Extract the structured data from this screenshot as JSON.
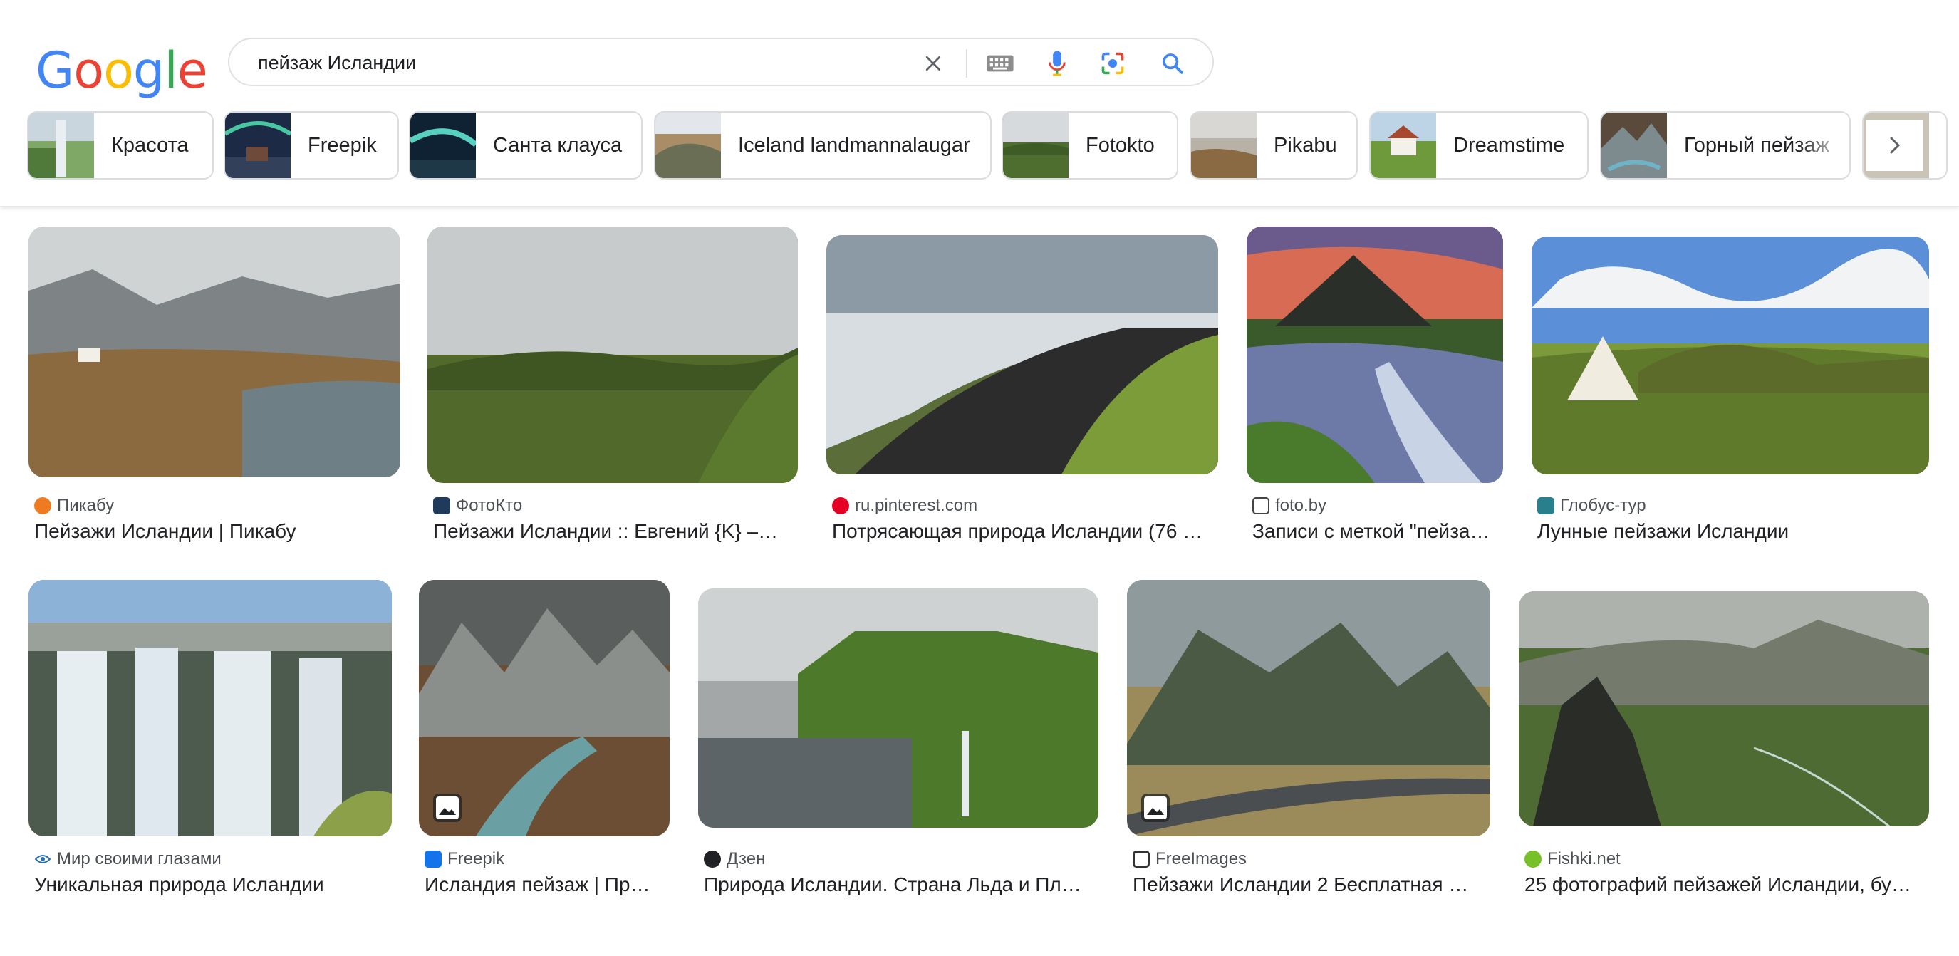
{
  "search": {
    "query": "пейзаж Исландии"
  },
  "logo": {
    "letters": [
      "G",
      "o",
      "o",
      "g",
      "l",
      "e"
    ],
    "colors": [
      "#4285F4",
      "#EA4335",
      "#FBBC05",
      "#4285F4",
      "#34A853",
      "#EA4335"
    ]
  },
  "chips": [
    {
      "label": "Красота"
    },
    {
      "label": "Freepik"
    },
    {
      "label": "Санта клауса"
    },
    {
      "label": "Iceland landmannalaugar"
    },
    {
      "label": "Fotokto"
    },
    {
      "label": "Pikabu"
    },
    {
      "label": "Dreamstime"
    },
    {
      "label": "Горный пейзаж"
    }
  ],
  "results": [
    {
      "source": "Пикабу",
      "title": "Пейзажи Исландии | Пикабу"
    },
    {
      "source": "ФотоКто",
      "title": "Пейзажи Исландии :: Евгений {K} –…"
    },
    {
      "source": "ru.pinterest.com",
      "title": "Потрясающая природа Исландии (76 …"
    },
    {
      "source": "foto.by",
      "title": "Записи с меткой \"пейза…"
    },
    {
      "source": "Глобус-тур",
      "title": "Лунные пейзажи Исландии"
    },
    {
      "source": "Мир своими глазами",
      "title": "Уникальная природа Исландии"
    },
    {
      "source": "Freepik",
      "title": "Исландия пейзаж | Пр…"
    },
    {
      "source": "Дзен",
      "title": "Природа Исландии. Страна Льда и Пл…"
    },
    {
      "source": "FreeImages",
      "title": "Пейзажи Исландии 2 Бесплатная …"
    },
    {
      "source": "Fishki.net",
      "title": "25 фотографий пейзажей Исландии, бу…"
    }
  ]
}
